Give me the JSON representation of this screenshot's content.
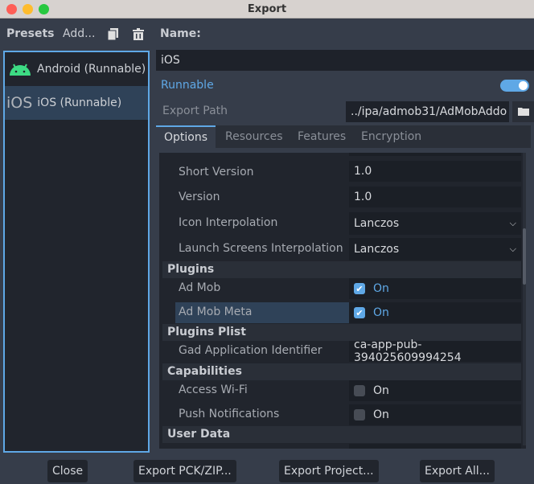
{
  "window": {
    "title": "Export"
  },
  "presets": {
    "label": "Presets",
    "add_label": "Add...",
    "items": [
      {
        "label": "Android (Runnable)",
        "icon": "android-icon"
      },
      {
        "label": "iOS (Runnable)",
        "icon": "ios-icon",
        "icon_text": "iOS",
        "selected": true
      }
    ]
  },
  "details": {
    "name_label": "Name:",
    "name_value": "iOS",
    "runnable_label": "Runnable",
    "runnable_on": true,
    "export_path_label": "Export Path",
    "export_path_value": "../ipa/admob31/AdMobAddo"
  },
  "tabs": [
    "Options",
    "Resources",
    "Features",
    "Encryption"
  ],
  "options": {
    "short_version": {
      "label": "Short Version",
      "value": "1.0"
    },
    "version": {
      "label": "Version",
      "value": "1.0"
    },
    "icon_interpolation": {
      "label": "Icon Interpolation",
      "value": "Lanczos"
    },
    "launch_interpolation": {
      "label": "Launch Screens Interpolation",
      "value": "Lanczos"
    },
    "plugins_header": "Plugins",
    "ad_mob": {
      "label": "Ad Mob",
      "value": "On",
      "checked": true
    },
    "ad_mob_meta": {
      "label": "Ad Mob Meta",
      "value": "On",
      "checked": true
    },
    "plist_header": "Plugins Plist",
    "gad": {
      "label": "Gad Application Identifier",
      "value": "ca-app-pub-394025609994254"
    },
    "capabilities_header": "Capabilities",
    "wifi": {
      "label": "Access Wi-Fi",
      "value": "On",
      "checked": false
    },
    "push": {
      "label": "Push Notifications",
      "value": "On",
      "checked": false
    },
    "user_data_header": "User Data"
  },
  "footer": {
    "close": "Close",
    "export_pck": "Export PCK/ZIP...",
    "export_project": "Export Project...",
    "export_all": "Export All..."
  },
  "colors": {
    "accent": "#5fa8e6",
    "android": "#3ddc84"
  }
}
